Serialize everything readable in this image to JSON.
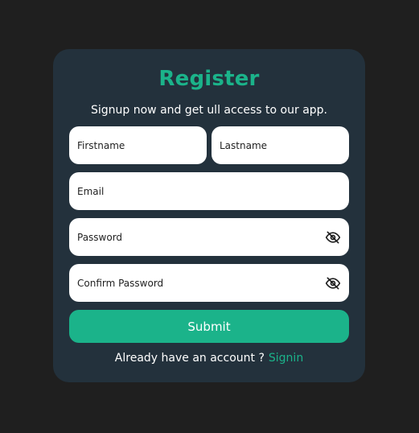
{
  "register": {
    "title": "Register",
    "subtitle": "Signup now and get ull access to our app.",
    "firstname": "Firstname",
    "lastname": "Lastname",
    "email": "Email",
    "password": "Password",
    "confirm_password": "Confirm Password",
    "submit": "Submit",
    "footer_text": "Already have an account ?",
    "signin": "Signin"
  },
  "colors": {
    "page_bg": "#1f1f1f",
    "card_bg": "#23313c",
    "accent": "#1bb38a",
    "field_bg": "#ffffff",
    "text_on_dark": "#ffffff",
    "text_on_light": "#1f1f1f"
  },
  "icons": {
    "password_visibility": "eye-slash-icon",
    "confirm_password_visibility": "eye-slash-icon"
  }
}
